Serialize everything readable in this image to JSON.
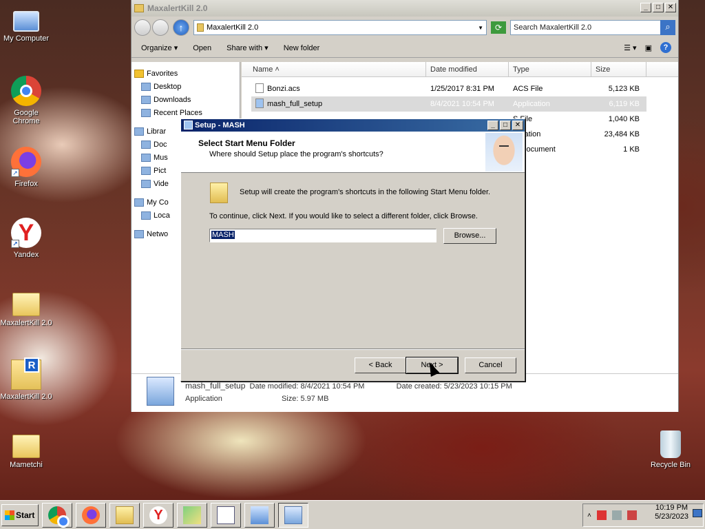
{
  "desktop": {
    "icons": [
      {
        "label": "My Computer"
      },
      {
        "label": "Google Chrome"
      },
      {
        "label": "Firefox"
      },
      {
        "label": "Yandex"
      },
      {
        "label": "MaxalertKill 2.0"
      },
      {
        "label": "MaxalertKill 2.0"
      },
      {
        "label": "Mametchi"
      },
      {
        "label": "Recycle Bin"
      }
    ]
  },
  "explorer": {
    "title": "MaxalertKill 2.0",
    "address": "MaxalertKill 2.0",
    "search_placeholder": "Search MaxalertKill 2.0",
    "toolbar": {
      "organize": "Organize",
      "open": "Open",
      "share_with": "Share with",
      "new_folder": "New folder"
    },
    "nav": {
      "favorites": "Favorites",
      "desktop": "Desktop",
      "downloads": "Downloads",
      "recent_places": "Recent Places",
      "libraries": "Librar",
      "documents": "Doc",
      "music": "Mus",
      "pictures": "Pict",
      "videos": "Vide",
      "my_computer": "My Co",
      "local_disk": "Loca",
      "network": "Netwo"
    },
    "columns": {
      "name": "Name",
      "date": "Date modified",
      "type": "Type",
      "size": "Size"
    },
    "files": [
      {
        "name": "Bonzi.acs",
        "date": "1/25/2017 8:31 PM",
        "type": "ACS File",
        "size": "5,123 KB"
      },
      {
        "name": "mash_full_setup",
        "date": "8/4/2021 10:54 PM",
        "type": "Application",
        "size": "6,119 KB"
      },
      {
        "name": "",
        "date": "",
        "type": "S File",
        "size": "1,040 KB"
      },
      {
        "name": "",
        "date": "",
        "type": "plication",
        "size": "23,484 KB"
      },
      {
        "name": "",
        "date": "",
        "type": "xt Document",
        "size": "1 KB"
      }
    ],
    "details": {
      "name": "mash_full_setup",
      "date_modified": "Date modified: 8/4/2021 10:54 PM",
      "date_created": "Date created: 5/23/2023 10:15 PM",
      "type": "Application",
      "size": "Size: 5.97 MB"
    }
  },
  "setup": {
    "title": "Setup - MASH",
    "heading": "Select Start Menu Folder",
    "subheading": "Where should Setup place the program's shortcuts?",
    "info": "Setup will create the program's shortcuts in the following Start Menu folder.",
    "instructions": "To continue, click Next. If you would like to select a different folder, click Browse.",
    "folder_value": "MASH",
    "browse": "Browse...",
    "back": "< Back",
    "next": "Next >",
    "cancel": "Cancel"
  },
  "taskbar": {
    "start": "Start",
    "time": "10:19 PM",
    "date": "5/23/2023"
  }
}
